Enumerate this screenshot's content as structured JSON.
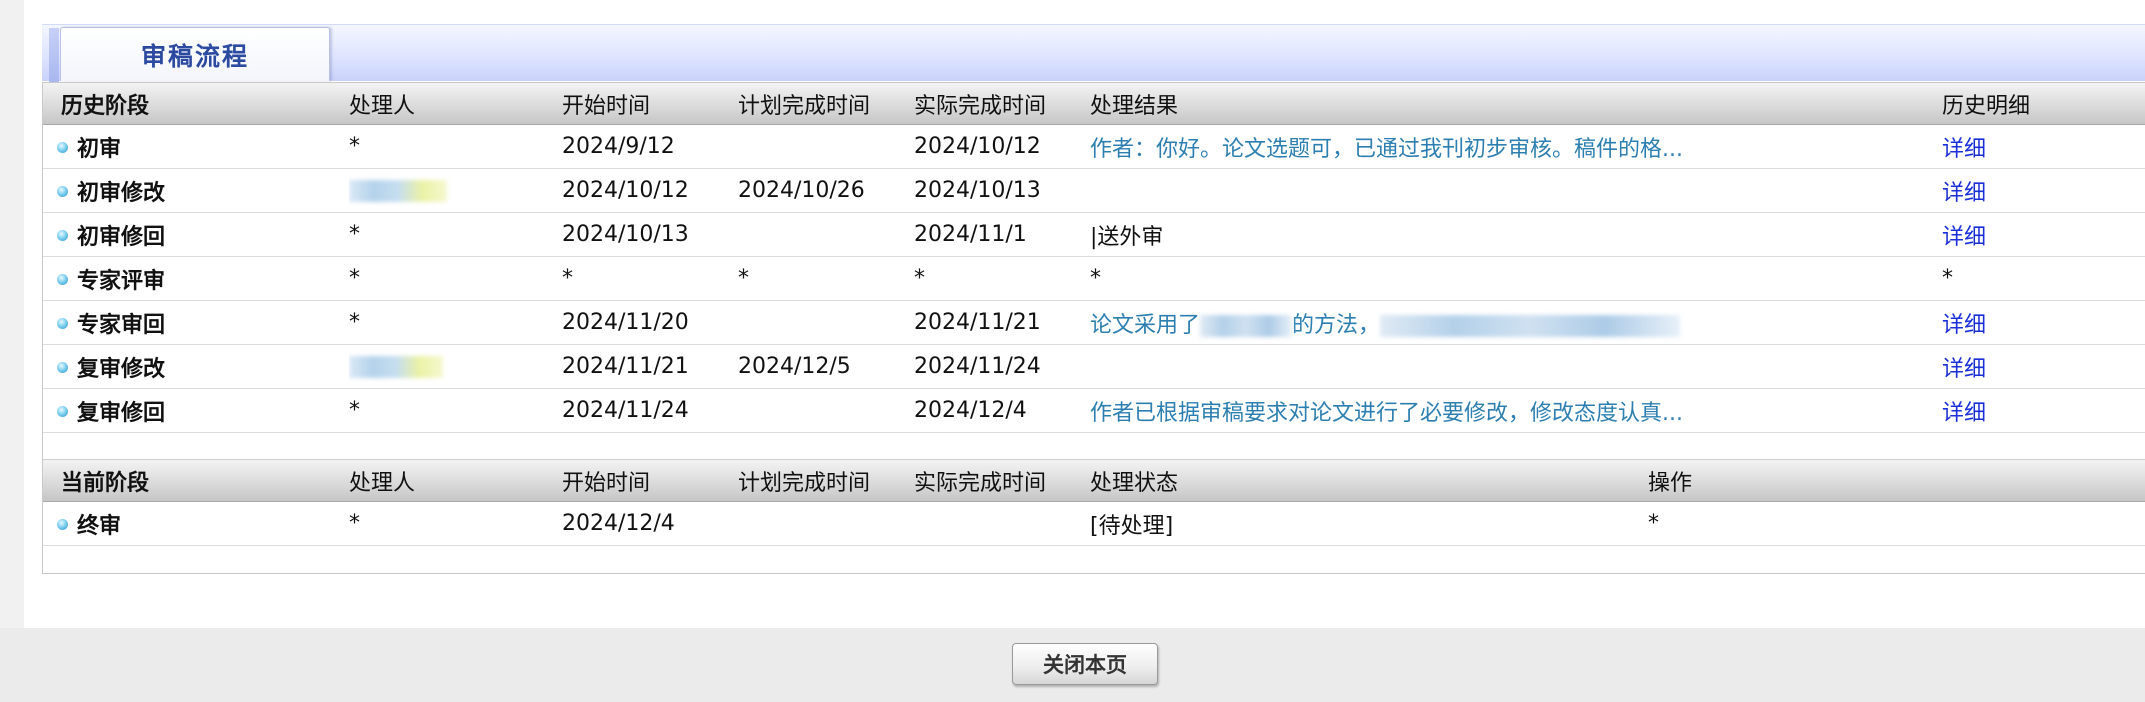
{
  "tab_title": "审稿流程",
  "history": {
    "headers": [
      "历史阶段",
      "处理人",
      "开始时间",
      "计划完成时间",
      "实际完成时间",
      "处理结果",
      "历史明细"
    ],
    "rows": [
      {
        "stage": "初审",
        "handler": "*",
        "start": "2024/9/12",
        "planned": "",
        "actual": "2024/10/12",
        "result": "作者：你好。论文选题可，已通过我刊初步审核。稿件的格...",
        "result_link": true,
        "detail": "详细"
      },
      {
        "stage": "初审修改",
        "handler": "",
        "handler_redacted": true,
        "start": "2024/10/12",
        "planned": "2024/10/26",
        "actual": "2024/10/13",
        "result": "",
        "result_link": false,
        "detail": "详细"
      },
      {
        "stage": "初审修回",
        "handler": "*",
        "start": "2024/10/13",
        "planned": "",
        "actual": "2024/11/1",
        "result": "|送外审",
        "result_link": false,
        "detail": "详细"
      },
      {
        "stage": "专家评审",
        "handler": "*",
        "start": "*",
        "planned": "*",
        "actual": "*",
        "result": "*",
        "result_link": false,
        "detail": "*"
      },
      {
        "stage": "专家审回",
        "handler": "*",
        "start": "2024/11/20",
        "planned": "",
        "actual": "2024/11/21",
        "result_prefix": "论文采用了",
        "result_mid": "的方法，",
        "result_redacted": true,
        "result_link": true,
        "detail": "详细"
      },
      {
        "stage": "复审修改",
        "handler": "",
        "handler_redacted": true,
        "start": "2024/11/21",
        "planned": "2024/12/5",
        "actual": "2024/11/24",
        "result": "",
        "result_link": false,
        "detail": "详细"
      },
      {
        "stage": "复审修回",
        "handler": "*",
        "start": "2024/11/24",
        "planned": "",
        "actual": "2024/12/4",
        "result": "作者已根据审稿要求对论文进行了必要修改，修改态度认真...",
        "result_link": true,
        "detail": "详细"
      }
    ]
  },
  "current": {
    "headers": [
      "当前阶段",
      "处理人",
      "开始时间",
      "计划完成时间",
      "实际完成时间",
      "处理状态",
      "操作"
    ],
    "rows": [
      {
        "stage": "终审",
        "handler": "*",
        "start": "2024/12/4",
        "planned": "",
        "actual": "",
        "status": "[待处理]",
        "action": "*"
      }
    ]
  },
  "close_button": "关闭本页",
  "colors": {
    "link_teal": "#2c7fb0",
    "link_blue": "#1a2fd6",
    "tab_text": "#2b4aa0"
  }
}
